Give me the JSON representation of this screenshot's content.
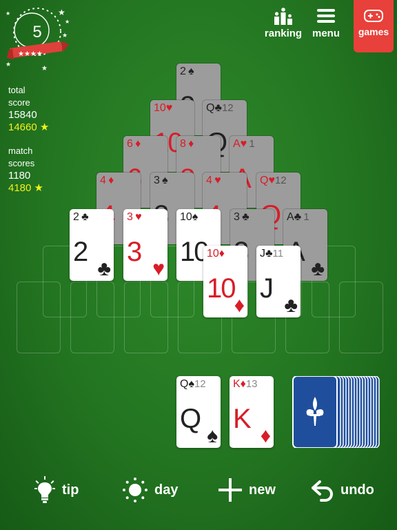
{
  "level": "5",
  "scores": {
    "total_label_1": "total",
    "total_label_2": "score",
    "total_value": "15840",
    "total_best": "14660 ★",
    "match_label_1": "match",
    "match_label_2": "scores",
    "match_value": "1180",
    "match_best": "4180 ★"
  },
  "nav": {
    "ranking": "ranking",
    "menu": "menu",
    "games": "games"
  },
  "cards": {
    "r0_2s": {
      "rank": "2",
      "suit": "♠",
      "pts": ""
    },
    "r1_10h": {
      "rank": "10",
      "suit": "♥",
      "pts": ""
    },
    "r1_qc": {
      "rank": "Q",
      "suit": "♣",
      "pts": "12"
    },
    "r2_6d": {
      "rank": "6",
      "suit": "♦",
      "pts": ""
    },
    "r2_8d": {
      "rank": "8",
      "suit": "♦",
      "pts": ""
    },
    "r2_ah": {
      "rank": "A",
      "suit": "♥",
      "pts": "1"
    },
    "r3_4d": {
      "rank": "4",
      "suit": "♦",
      "pts": ""
    },
    "r3_3s": {
      "rank": "3",
      "suit": "♠",
      "pts": ""
    },
    "r3_4h": {
      "rank": "4",
      "suit": "♥",
      "pts": ""
    },
    "r3_qh": {
      "rank": "Q",
      "suit": "♥",
      "pts": "12"
    },
    "r4_2c": {
      "rank": "2",
      "suit": "♣",
      "pts": ""
    },
    "r4_3h": {
      "rank": "3",
      "suit": "♥",
      "pts": ""
    },
    "r4_10s": {
      "rank": "10",
      "suit": "♠",
      "pts": ""
    },
    "r4_3c": {
      "rank": "3",
      "suit": "♣",
      "pts": ""
    },
    "r4_ac": {
      "rank": "A",
      "suit": "♣",
      "pts": "1"
    },
    "r5_10d": {
      "rank": "10",
      "suit": "♦",
      "pts": ""
    },
    "r5_jc": {
      "rank": "J",
      "suit": "♣",
      "pts": "11"
    },
    "waste_qs": {
      "rank": "Q",
      "suit": "♠",
      "pts": "12"
    },
    "waste_kd": {
      "rank": "K",
      "suit": "♦",
      "pts": "13"
    }
  },
  "toolbar": {
    "tip": "tip",
    "day": "day",
    "new": "new",
    "undo": "undo"
  },
  "colors": {
    "felt": "#237521",
    "red_suit": "#d81d28",
    "games_bg": "#e8403a",
    "star": "#f1f01c",
    "deck_back": "#1f4f9c"
  },
  "icons": {
    "ranking": "podium-icon",
    "menu": "hamburger-icon",
    "games": "gamepad-icon",
    "tip": "lightbulb-icon",
    "day": "sun-icon",
    "new": "plus-icon",
    "undo": "undo-arrow-icon",
    "deck": "fleur-de-lis-icon"
  }
}
